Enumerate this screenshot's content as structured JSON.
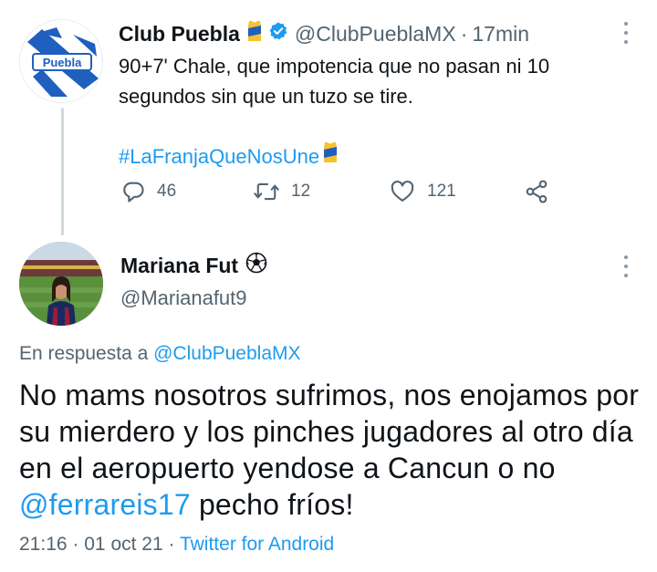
{
  "parent_tweet": {
    "display_name": "Club Puebla",
    "handle": "@ClubPueblaMX",
    "separator": "·",
    "time": "17min",
    "text_line1": "90+7' Chale, que impotencia que no pasan ni 10",
    "text_line2": "segundos sin que un tuzo se tire.",
    "hashtag": "#LaFranjaQueNosUne",
    "avatar_logo_text": "Puebla",
    "stats": {
      "replies": "46",
      "retweets": "12",
      "likes": "121"
    },
    "icons": {
      "jersey": "jersey-emoji-icon",
      "verified": "verified-badge-icon",
      "reply": "reply-icon",
      "retweet": "retweet-icon",
      "like": "heart-icon",
      "share": "share-icon",
      "more": "more-options-icon"
    }
  },
  "reply_tweet": {
    "display_name": "Mariana Fut",
    "handle": "@Marianafut9",
    "reply_prefix": "En respuesta a",
    "reply_mention": "@ClubPueblaMX",
    "text_part1": "No mams nosotros sufrimos, nos enojamos por su mierdero y los pinches jugadores al otro día en el aeropuerto yendose a Cancun o no",
    "text_mention": "@ferrareis17",
    "text_part2": "pecho fríos!",
    "time": "21:16",
    "date": "01 oct 21",
    "separator": "·",
    "source": "Twitter for Android",
    "icons": {
      "soccer": "soccer-ball-icon",
      "more": "more-options-icon"
    }
  },
  "colors": {
    "accent": "#1d9bf0",
    "secondary_text": "#536471",
    "primary_text": "#0f1419",
    "puebla_blue": "#1f5fbf"
  }
}
